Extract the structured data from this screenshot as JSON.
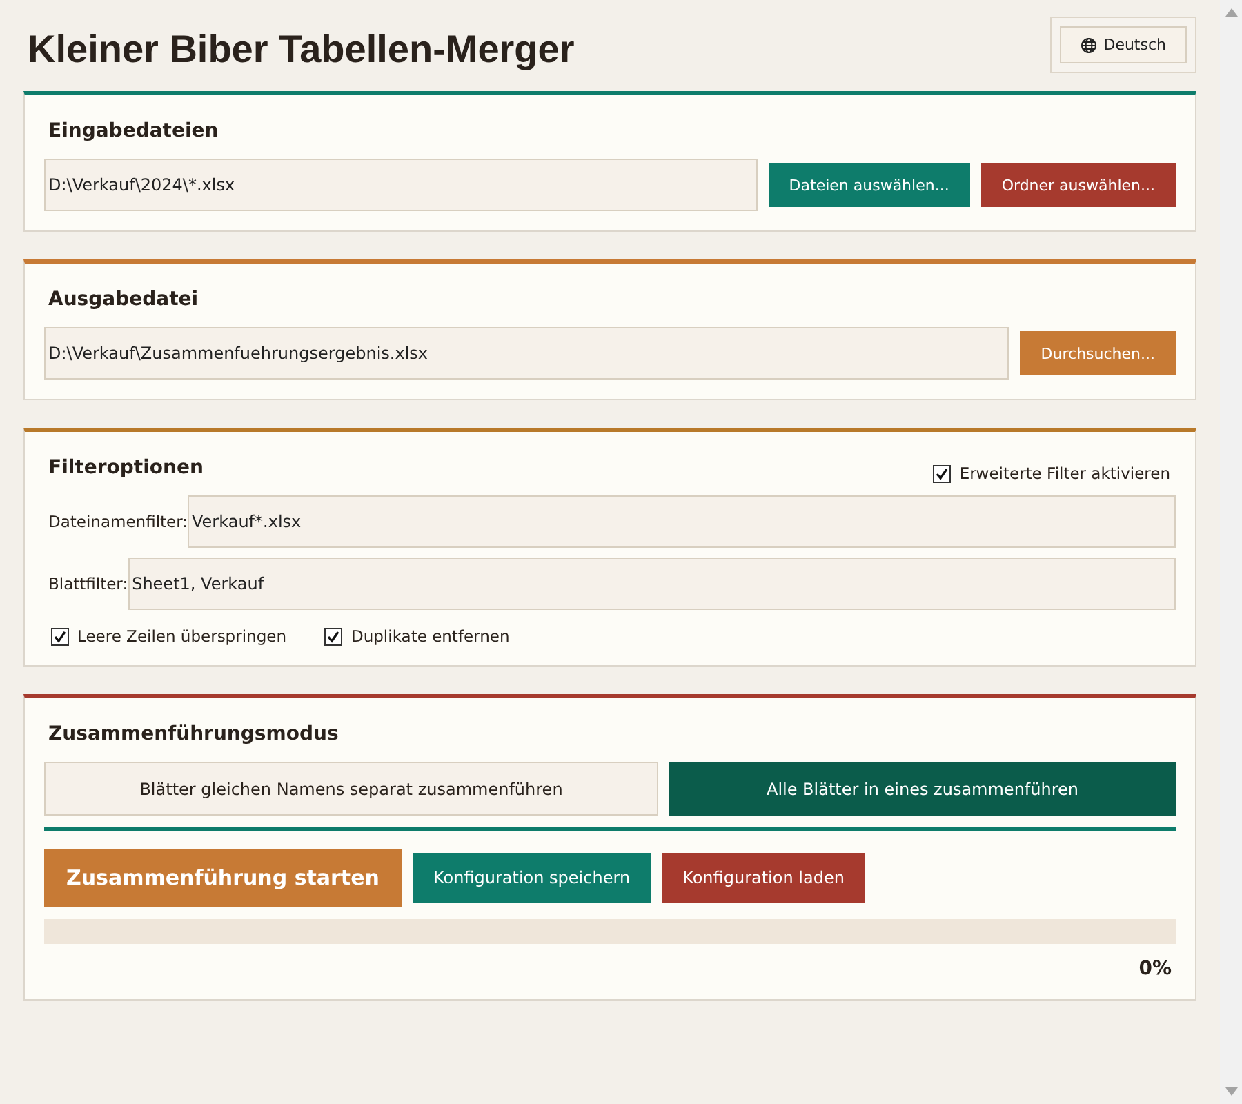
{
  "title": "Kleiner Biber Tabellen-Merger",
  "language_button": "Deutsch",
  "input_section": {
    "heading": "Eingabedateien",
    "path": "D:\\Verkauf\\2024\\*.xlsx",
    "buttons": [
      {
        "label": "Dateien auswählen...",
        "kind": "teal"
      },
      {
        "label": "Ordner auswählen...",
        "kind": "red"
      }
    ]
  },
  "output_section": {
    "heading": "Ausgabedatei",
    "path": "D:\\Verkauf\\Zusammenfuehrungsergebnis.xlsx",
    "button": "Durchsuchen..."
  },
  "filter_section": {
    "heading": "Filteroptionen",
    "advanced": {
      "label": "Erweiterte Filter aktivieren",
      "checked": true
    },
    "fields": [
      {
        "label": "Dateinamenfilter:",
        "value": "Verkauf*.xlsx"
      },
      {
        "label": "Blattfilter:",
        "value": "Sheet1, Verkauf"
      }
    ],
    "options": [
      {
        "label": "Leere Zeilen überspringen",
        "checked": true
      },
      {
        "label": "Duplikate entfernen",
        "checked": true
      }
    ]
  },
  "mode_section": {
    "heading": "Zusammenführungsmodus",
    "modes": [
      {
        "label": "Blätter gleichen Namens separat zusammenführen",
        "selected": false
      },
      {
        "label": "Alle Blätter in eines zusammenführen",
        "selected": true
      }
    ]
  },
  "actions": [
    {
      "label": "Zusammenführung starten",
      "kind": "primary"
    },
    {
      "label": "Konfiguration speichern",
      "kind": "teal"
    },
    {
      "label": "Konfiguration laden",
      "kind": "red"
    }
  ],
  "progress": {
    "reading": "0%"
  }
}
